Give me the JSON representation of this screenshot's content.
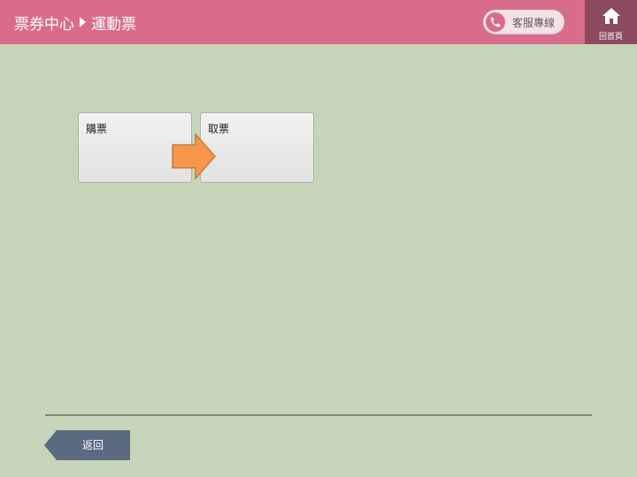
{
  "header": {
    "breadcrumb": {
      "root": "票券中心",
      "current": "運動票"
    },
    "service_label": "客服專線",
    "home_label": "回首頁"
  },
  "tiles": [
    {
      "label": "購票"
    },
    {
      "label": "取票"
    }
  ],
  "footer": {
    "back_label": "返回"
  },
  "colors": {
    "header_bg": "#d96c8c",
    "home_bg": "#8c4a5e",
    "page_bg": "#c6d5b9",
    "arrow": "#f7964a",
    "back_button": "#5a6a80"
  }
}
